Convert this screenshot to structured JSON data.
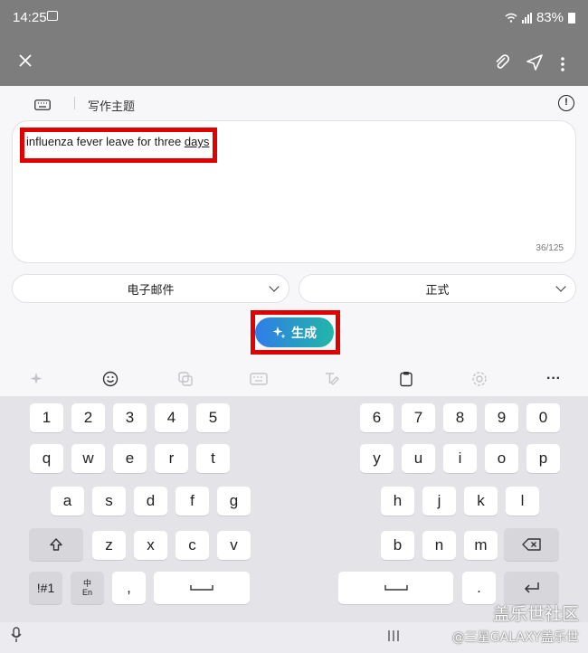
{
  "status_bar": {
    "time": "14:25",
    "battery": "83%"
  },
  "panel": {
    "topic_label": "写作主题",
    "info_glyph": "!",
    "input_text_before": "influenza fever leave for three ",
    "input_text_underlined": "days",
    "counter": "36/125",
    "format_select": "电子邮件",
    "tone_select": "正式",
    "generate_label": "生成",
    "highlight_color": "#e00000",
    "accent_gradient": [
      "#2f7de8",
      "#22b6a8"
    ]
  },
  "toolbar": {
    "icons": [
      "ai-sparkle-icon",
      "emoji-icon",
      "sticker-icon",
      "keyboard-icon",
      "handwriting-icon",
      "clipboard-icon",
      "settings-icon",
      "more-icon"
    ],
    "more_glyph": "···"
  },
  "keyboard": {
    "row_numbers_left": [
      "1",
      "2",
      "3",
      "4",
      "5"
    ],
    "row_numbers_right": [
      "6",
      "7",
      "8",
      "9",
      "0"
    ],
    "row_q_left": [
      "q",
      "w",
      "e",
      "r",
      "t"
    ],
    "row_q_right": [
      "y",
      "u",
      "i",
      "o",
      "p"
    ],
    "row_a_left": [
      "a",
      "s",
      "d",
      "f",
      "g"
    ],
    "row_a_right": [
      "h",
      "j",
      "k",
      "l"
    ],
    "row_z_left": [
      "z",
      "x",
      "c",
      "v"
    ],
    "row_z_right": [
      "b",
      "n",
      "m"
    ],
    "symbols_key": "!#1",
    "lang_key_top": "中",
    "lang_key_bottom": "En",
    "comma_key": ",",
    "period_key": "."
  },
  "watermark": {
    "line1": "盖乐世社区",
    "line2": "@三星GALAXY盖乐世"
  }
}
